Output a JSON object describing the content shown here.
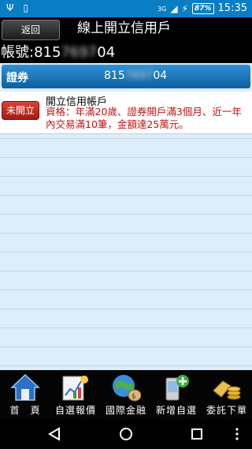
{
  "status_bar": {
    "network": "3G",
    "battery": "87%",
    "time": "15:35"
  },
  "header": {
    "back_label": "返回",
    "title": "線上開立信用戶"
  },
  "account": {
    "label": "帳號:",
    "prefix": "815",
    "hidden": "7697",
    "suffix": "04"
  },
  "securities": {
    "label": "證券",
    "account_prefix": "815",
    "account_hidden": "7697",
    "account_suffix": "04"
  },
  "rows": [
    {
      "status": "未開立",
      "title": "開立信用帳戶",
      "description": "資格：年滿20歲、證券開戶滿3個月、近一年內交易滿10筆，金額達25萬元。"
    }
  ],
  "bottom_nav": [
    {
      "label": "首　頁",
      "icon": "home-icon"
    },
    {
      "label": "自選報價",
      "icon": "quote-chart-icon"
    },
    {
      "label": "國際金融",
      "icon": "globe-money-icon"
    },
    {
      "label": "新增自選",
      "icon": "add-phone-icon"
    },
    {
      "label": "委託下單",
      "icon": "gold-coins-icon"
    }
  ],
  "colors": {
    "status_bar": "#0a7ec4",
    "list_bg": "#ddeefa",
    "badge": "#c0281f",
    "desc_text": "#c31212"
  }
}
